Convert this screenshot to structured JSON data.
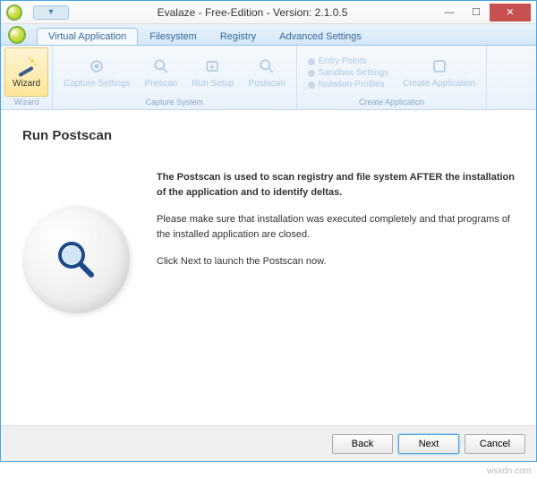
{
  "titlebar": {
    "title": "Evalaze - Free-Edition - Version: 2.1.0.5",
    "help": "▾"
  },
  "tabs": {
    "items": [
      {
        "label": "Virtual Application",
        "active": true
      },
      {
        "label": "Filesystem",
        "active": false
      },
      {
        "label": "Registry",
        "active": false
      },
      {
        "label": "Advanced Settings",
        "active": false
      }
    ]
  },
  "ribbon": {
    "groups": [
      {
        "label": "Wizard",
        "buttons": [
          {
            "label": "Wizard",
            "active": true,
            "icon": "wand"
          }
        ]
      },
      {
        "label": "Capture System",
        "buttons": [
          {
            "label": "Capture Settings",
            "active": false,
            "icon": "gear"
          },
          {
            "label": "Prescan",
            "active": false,
            "icon": "magnifier"
          },
          {
            "label": "Run Setup",
            "active": false,
            "icon": "run"
          },
          {
            "label": "Postscan",
            "active": false,
            "icon": "magnifier"
          }
        ]
      },
      {
        "label": "Create Application",
        "buttons": [
          {
            "label": "",
            "active": false,
            "icon": "list",
            "list": [
              "Entry Points",
              "Sandbox Settings",
              "Isolation-Profiles"
            ]
          },
          {
            "label": "Create Application",
            "active": false,
            "icon": "create"
          }
        ]
      }
    ]
  },
  "page": {
    "title": "Run Postscan",
    "p1": "The Postscan is used to scan registry and file system AFTER the installation of the application and to identify deltas.",
    "p2": "Please make sure that installation was executed completely and that programs of the installed application are closed.",
    "p3": "Click Next to launch the Postscan now."
  },
  "footer": {
    "back": "Back",
    "next": "Next",
    "cancel": "Cancel"
  },
  "watermark": "wsxdn.com"
}
